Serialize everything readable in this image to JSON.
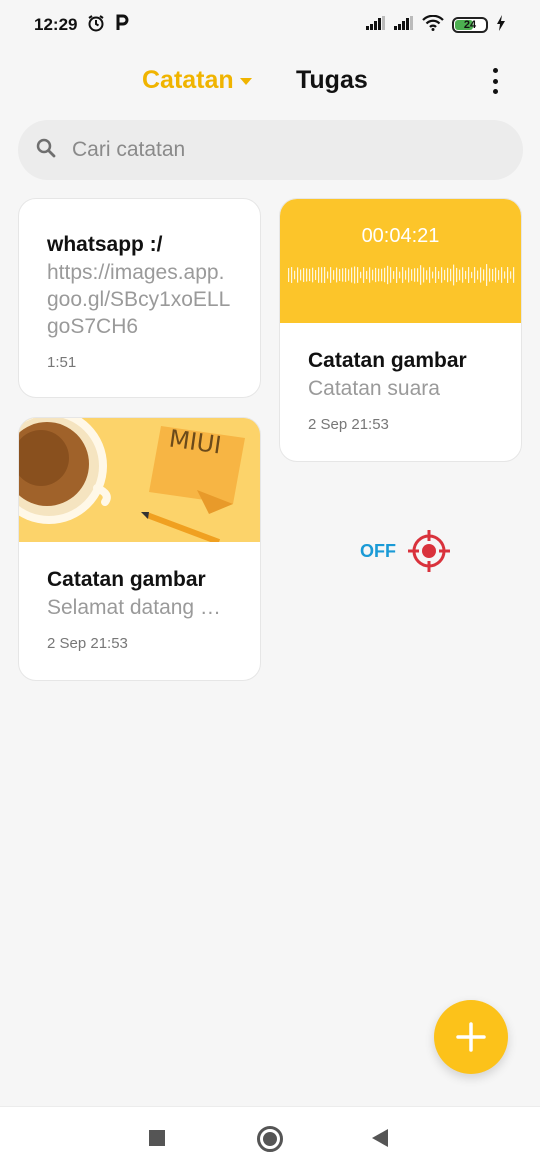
{
  "status_bar": {
    "time": "12:29",
    "battery": "24",
    "icons": [
      "alarm-icon",
      "parking-icon",
      "signal-icon",
      "signal-icon",
      "wifi-icon",
      "battery-icon",
      "charging-icon"
    ]
  },
  "header": {
    "tabs": [
      {
        "label": "Catatan",
        "active": true
      },
      {
        "label": "Tugas",
        "active": false
      }
    ],
    "accent_color": "#f0b400"
  },
  "search": {
    "placeholder": "Cari catatan"
  },
  "notes": [
    {
      "title": "whatsapp :/",
      "body": "https://images.app.goo.gl/SBcy1xoELLgoS7CH6",
      "date": "1:51"
    },
    {
      "type": "audio",
      "duration": "00:04:21",
      "title": "Catatan gambar",
      "body": "Catatan suara",
      "date": "2 Sep 21:53"
    },
    {
      "type": "image",
      "image_text": "MIUI",
      "title": "Catatan gambar",
      "body": "Selamat datang …",
      "date": "2 Sep 21:53"
    }
  ],
  "overlay": {
    "off_label": "OFF"
  },
  "fab": {
    "icon": "plus-icon",
    "color": "#fcc21a"
  },
  "nav_bar": {
    "icons": [
      "recent-apps-icon",
      "home-icon",
      "back-icon"
    ]
  }
}
